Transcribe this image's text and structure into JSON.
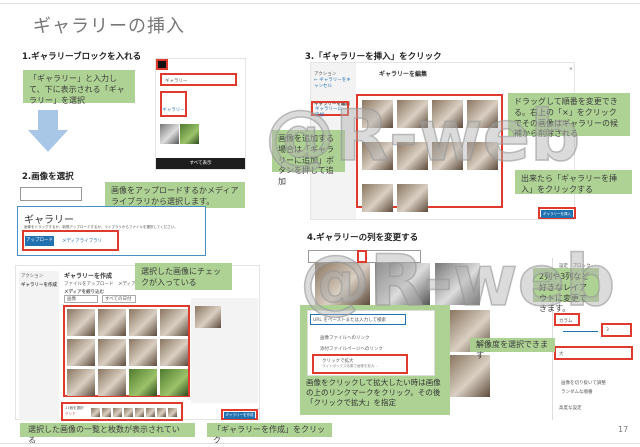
{
  "title": "ギャラリーの挿入",
  "page_number": "17",
  "watermark": "@R-web",
  "step1": {
    "heading": "1.ギャラリーブロックを入れる",
    "callout": "「ギャラリー」と入力して、下に表示される「ギャラリー」を選択",
    "search_value": "ギャラリー",
    "result_label": "ギャラリー",
    "browse_all": "すべて表示"
  },
  "step2": {
    "heading": "2.画像を選択",
    "callout": "画像をアップロードするかメディアライブラリから選択します。",
    "block_title": "ギャラリー",
    "block_desc": "画像をドラッグするか、新規アップロードするか、ライブラリからファイルを選択してください。",
    "upload": "アップロード",
    "media_library": "メディアライブラリ",
    "modal_sidebar": [
      "アクション",
      "ギャラリーを作成"
    ],
    "modal_title": "ギャラリーを作成",
    "modal_tabs": [
      "ファイルをアップロード",
      "メディアライブラリ"
    ],
    "filter_label": "メディアを絞り込む",
    "filter_value": "画像",
    "date_filter": "すべての日付",
    "callout_checked": "選択した画像にチェックが入っている",
    "selected_count": "11個を選択",
    "clear": "クリア",
    "callout_list": "選択した画像の一覧と枚数が表示されている",
    "create_button": "ギャラリーを作成",
    "callout_create": "「ギャラリーを作成」をクリック"
  },
  "step3": {
    "heading": "3.「ギャラリーを挿入」をクリック",
    "modal_title": "ギャラリーを編集",
    "modal_sidebar": [
      "アクション",
      "← ギャラリーをキャンセル",
      "ギャラリーを編集",
      "ギャラリーに追加"
    ],
    "callout_add": "画像を追加する場合は「ギャラリーに追加」ボタンを押して追加",
    "callout_drag": "ドラッグして順番を変更できる。右上の「×」をクリックでその画像はギャラリーの候補から削除される",
    "callout_insert": "出来たら「ギャラリーを挿入」をクリックする",
    "insert_button": "ギャラリーを挿入"
  },
  "step4": {
    "heading": "4.ギャラリーの列を変更する",
    "link_placeholder": "URL をペーストまたは入力して検索",
    "link_options": [
      {
        "label": "画像ファイルへのリンク"
      },
      {
        "label": "添付ファイルページへのリンク"
      },
      {
        "label": "クリックで拡大",
        "sub": "ライトボックス効果で画像を拡大..."
      }
    ],
    "callout_link": "画像をクリックして拡大したい時は画像の上のリンクマークをクリック。その後「クリックで拡大」を指定",
    "panel_tabs": [
      "設定",
      "ブロック"
    ],
    "callout_columns": "2列や3列など好きなレイアウトに変更できます。",
    "columns_label": "カラム",
    "columns_value": "3",
    "callout_resolution": "解像度を選択できます",
    "resolution_value": "大",
    "toggle_crop": "画像を切り抜いて調整",
    "toggle_random": "ランダムな順番",
    "advanced": "高度な設定"
  }
}
